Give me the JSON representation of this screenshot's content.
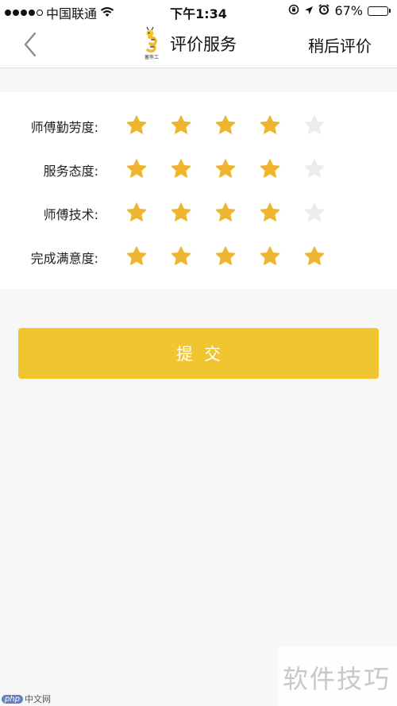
{
  "status_bar": {
    "carrier": "中国联通",
    "time": "下午1:34",
    "battery_percent": "67%",
    "battery_level": 0.67,
    "signal_bars_on": 4,
    "signal_bars_total": 5
  },
  "nav": {
    "logo_caption": "蓄熊工",
    "title": "评价服务",
    "later_label": "稍后评价"
  },
  "ratings": [
    {
      "label": "师傅勤劳度:",
      "stars": 4,
      "max": 5
    },
    {
      "label": "服务态度:",
      "stars": 4,
      "max": 5
    },
    {
      "label": "师傅技术:",
      "stars": 4,
      "max": 5
    },
    {
      "label": "完成满意度:",
      "stars": 5,
      "max": 5
    }
  ],
  "submit_label": "提交",
  "colors": {
    "accent": "#f0c52f",
    "star_on": "#efb52f",
    "star_off": "#ececec",
    "background": "#f7f7f7"
  },
  "watermark": {
    "text": "软件技巧",
    "php_badge": "php",
    "php_site": "中文网"
  }
}
